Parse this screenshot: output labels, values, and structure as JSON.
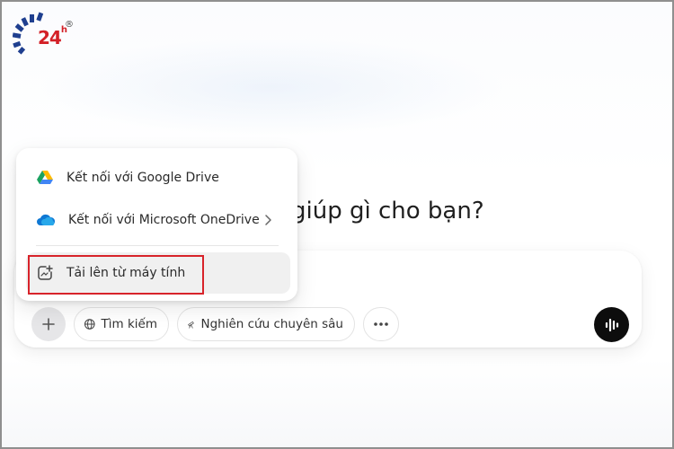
{
  "logo": {
    "text": "24",
    "sup": "h",
    "reg": "®"
  },
  "heading": "giúp gì cho bạn?",
  "menu": {
    "items": [
      {
        "label": "Kết nối với Google Drive",
        "icon": "google-drive-icon"
      },
      {
        "label": "Kết nối với Microsoft OneDrive",
        "icon": "onedrive-icon",
        "has_submenu": true
      },
      {
        "label": "Tải lên từ máy tính",
        "icon": "upload-file-icon",
        "highlighted": true
      }
    ]
  },
  "toolbar": {
    "search_label": "Tìm kiếm",
    "research_label": "Nghiên cứu chuyên sâu",
    "more_label": "···"
  },
  "colors": {
    "highlight": "#d8232a",
    "voice_button": "#0d0d0d",
    "logo": "#d32027",
    "logo_blue": "#1f3f8f"
  }
}
